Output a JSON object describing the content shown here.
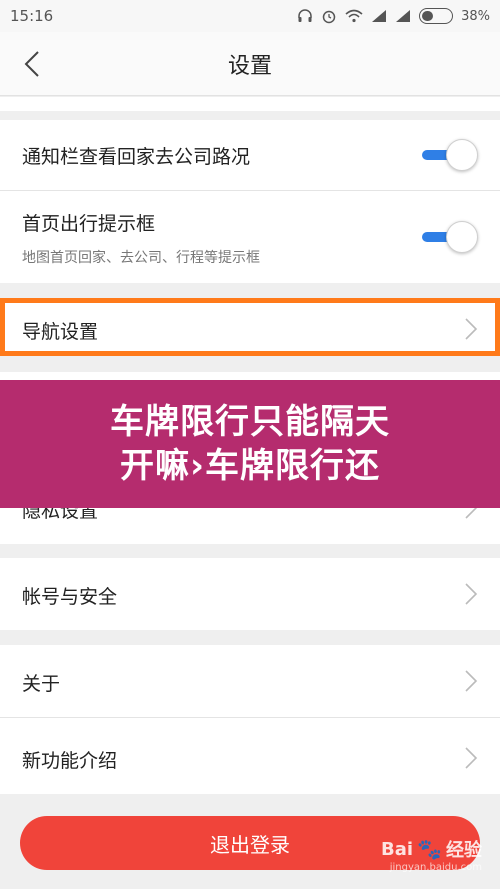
{
  "status_bar": {
    "time": "15:16",
    "battery": "38%",
    "battery_level": 0.38
  },
  "header": {
    "title": "设置"
  },
  "rows": {
    "notify_label": "通知栏查看回家去公司路况",
    "home_prompt_label": "首页出行提示框",
    "home_prompt_sub": "地图首页回家、去公司、行程等提示框",
    "nav_label": "导航设置",
    "privacy_label": "隐私设置",
    "account_label": "帐号与安全",
    "about_label": "关于",
    "new_features_label": "新功能介绍"
  },
  "toggles": {
    "notify_on": true,
    "home_prompt_on": true
  },
  "banner": {
    "line1": "车牌限行只能隔天",
    "line2": "开嘛›车牌限行还"
  },
  "logout_label": "退出登录",
  "watermark": {
    "brand": "Bai",
    "brand2": "经验",
    "url": "jingyan.baidu.com"
  },
  "colors": {
    "accent": "#2f7fe6",
    "highlight": "#ff7a1a",
    "banner": "#b52c6e",
    "logout": "#f0443a"
  }
}
